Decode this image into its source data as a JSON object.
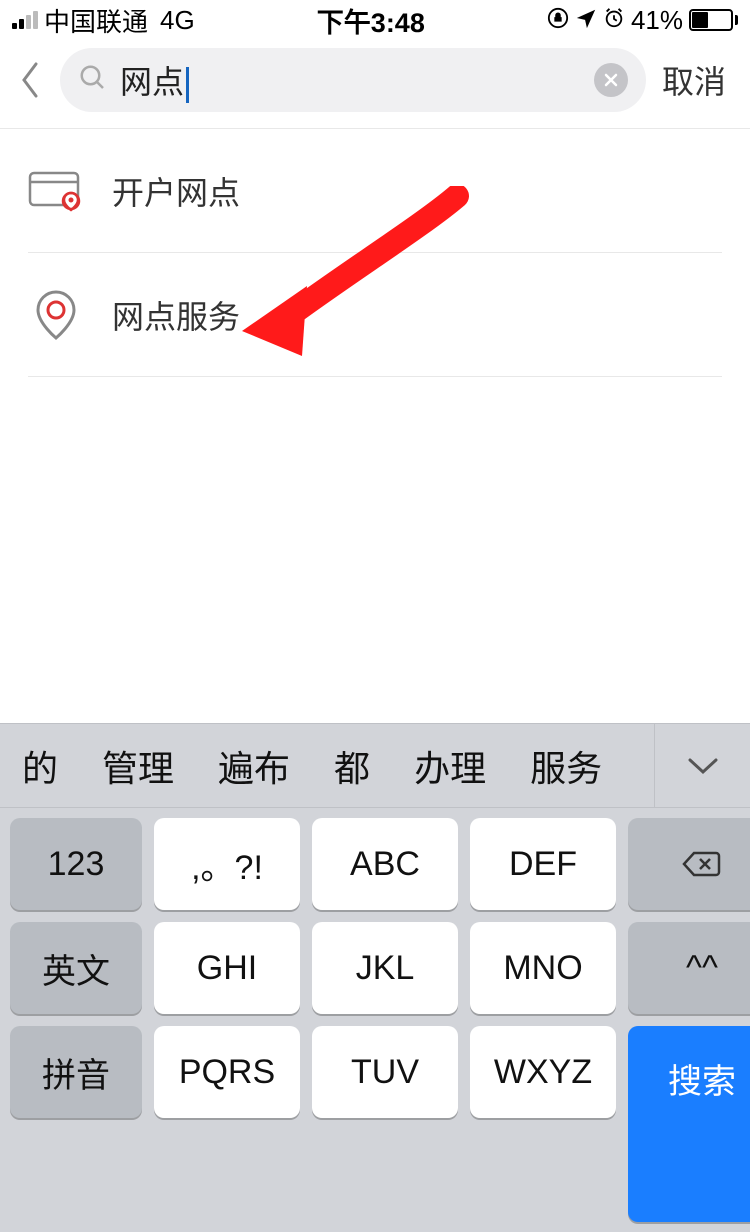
{
  "status": {
    "carrier": "中国联通",
    "network": "4G",
    "time": "下午3:48",
    "battery_pct": "41%"
  },
  "header": {
    "search_value": "网点",
    "cancel_label": "取消"
  },
  "results": [
    {
      "icon": "card-location-icon",
      "label": "开户网点"
    },
    {
      "icon": "location-pin-icon",
      "label": "网点服务"
    }
  ],
  "keyboard": {
    "suggestions": [
      "的",
      "管理",
      "遍布",
      "都",
      "办理",
      "服务"
    ],
    "rows": [
      [
        "123",
        ",。?!",
        "ABC",
        "DEF",
        "__backspace__"
      ],
      [
        "英文",
        "GHI",
        "JKL",
        "MNO",
        "^^"
      ],
      [
        "拼音",
        "PQRS",
        "TUV",
        "WXYZ",
        "搜索"
      ]
    ]
  }
}
